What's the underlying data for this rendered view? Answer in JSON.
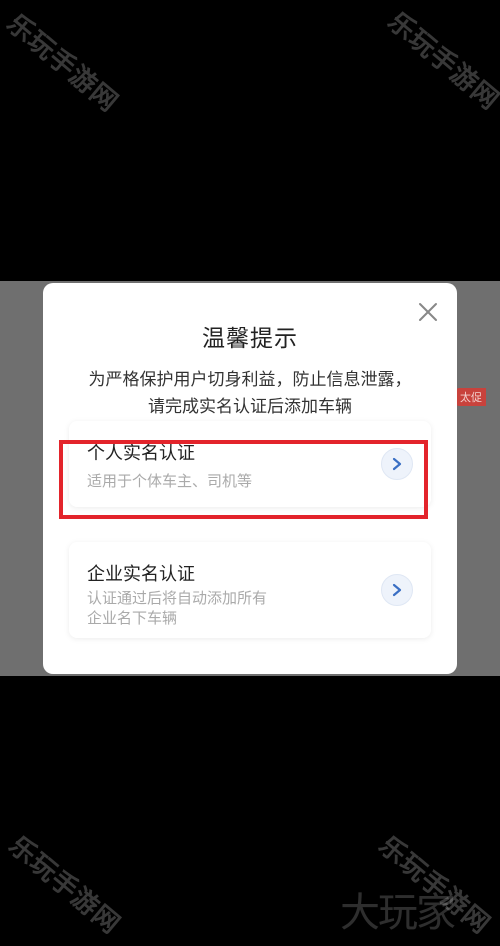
{
  "dialog": {
    "title": "温馨提示",
    "message_lines": [
      "为严格保护用户切身利益，防止信息泄露，",
      "请完成实名认证后添加车辆"
    ],
    "close_icon": "close-icon"
  },
  "options": [
    {
      "title": "个人实名认证",
      "subtitle_lines": [
        "适用于个体车主、司机等"
      ],
      "icon": "chevron-right-icon",
      "highlighted": true
    },
    {
      "title": "企业实名认证",
      "subtitle_lines": [
        "认证通过后将自动添加所有",
        "企业名下车辆"
      ],
      "icon": "chevron-right-icon",
      "highlighted": false
    }
  ],
  "background": {
    "tag": "太促"
  },
  "watermarks": {
    "site": "乐玩手游网",
    "logo": "大玩家"
  },
  "colors": {
    "highlight": "#e3242b",
    "accent": "#3a6fc4"
  }
}
